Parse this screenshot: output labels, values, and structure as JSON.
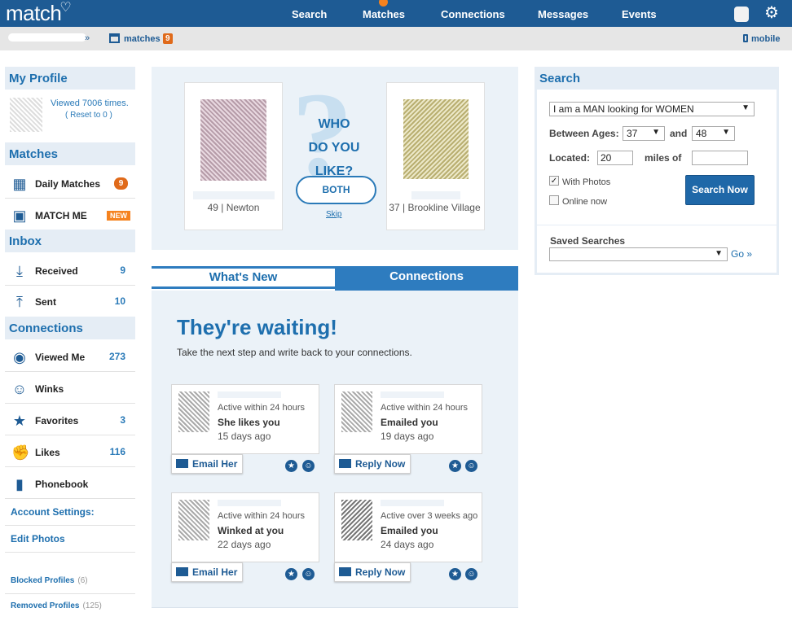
{
  "header": {
    "logo": "match",
    "nav": [
      "Search",
      "Matches",
      "Connections",
      "Messages",
      "Events"
    ]
  },
  "breadcrumb": {
    "separator": "»",
    "matches_label": "matches",
    "matches_count": "9",
    "mobile_label": "mobile"
  },
  "sidebar": {
    "my_profile": {
      "title": "My Profile",
      "viewed": "Viewed 7006 times.",
      "reset": "( Reset to 0 )"
    },
    "matches": {
      "title": "Matches",
      "items": [
        {
          "label": "Daily Matches",
          "badge": "9",
          "icon": "calendar-icon"
        },
        {
          "label": "MATCH ME",
          "badge": "NEW",
          "icon": "matchme-icon"
        }
      ]
    },
    "inbox": {
      "title": "Inbox",
      "items": [
        {
          "label": "Received",
          "count": "9",
          "icon": "inbox-received-icon"
        },
        {
          "label": "Sent",
          "count": "10",
          "icon": "inbox-sent-icon"
        }
      ]
    },
    "connections": {
      "title": "Connections",
      "items": [
        {
          "label": "Viewed Me",
          "count": "273",
          "icon": "eye-icon"
        },
        {
          "label": "Winks",
          "count": "",
          "icon": "wink-icon"
        },
        {
          "label": "Favorites",
          "count": "3",
          "icon": "star-icon"
        },
        {
          "label": "Likes",
          "count": "116",
          "icon": "thumbs-up-icon"
        },
        {
          "label": "Phonebook",
          "count": "",
          "icon": "phonebook-icon"
        }
      ]
    },
    "account_settings": "Account Settings:",
    "edit_photos": "Edit Photos",
    "blocked": {
      "label": "Blocked Profiles",
      "count": "(6)"
    },
    "removed": {
      "label": "Removed Profiles",
      "count": "(125)"
    }
  },
  "game": {
    "left_info": "49 | Newton",
    "right_info": "37 | Brookline Village",
    "question_lines": [
      "WHO",
      "DO YOU",
      "LIKE?"
    ],
    "both_label": "BOTH",
    "skip_label": "Skip"
  },
  "tabs": {
    "whats_new": "What's New",
    "connections": "Connections"
  },
  "panel": {
    "title": "They're waiting!",
    "subtitle": "Take the next step and write back to your connections.",
    "cards": [
      {
        "active": "Active within 24 hours",
        "status": "She likes you",
        "ago": "15 days ago",
        "action": "Email Her"
      },
      {
        "active": "Active within 24 hours",
        "status": "Emailed you",
        "ago": "19 days ago",
        "action": "Reply Now"
      },
      {
        "active": "Active within 24 hours",
        "status": "Winked at you",
        "ago": "22 days ago",
        "action": "Email Her"
      },
      {
        "active": "Active over 3 weeks ago",
        "status": "Emailed you",
        "ago": "24 days ago",
        "action": "Reply Now"
      }
    ]
  },
  "search": {
    "title": "Search",
    "seeking": "I am a MAN looking for WOMEN",
    "between_label": "Between Ages:",
    "age_min": "37",
    "and_label": "and",
    "age_max": "48",
    "located_label": "Located:",
    "miles_value": "20",
    "miles_of_label": "miles of",
    "zip_value": "",
    "with_photos_label": "With Photos",
    "with_photos_checked": true,
    "online_now_label": "Online now",
    "online_now_checked": false,
    "search_button": "Search Now",
    "saved_label": "Saved Searches",
    "saved_value": "",
    "go_label": "Go »"
  },
  "colors": {
    "nav_blue": "#1e5b94",
    "accent_blue": "#2e7cbf",
    "orange": "#f5821f",
    "panel_bg": "#ebf2f8"
  }
}
